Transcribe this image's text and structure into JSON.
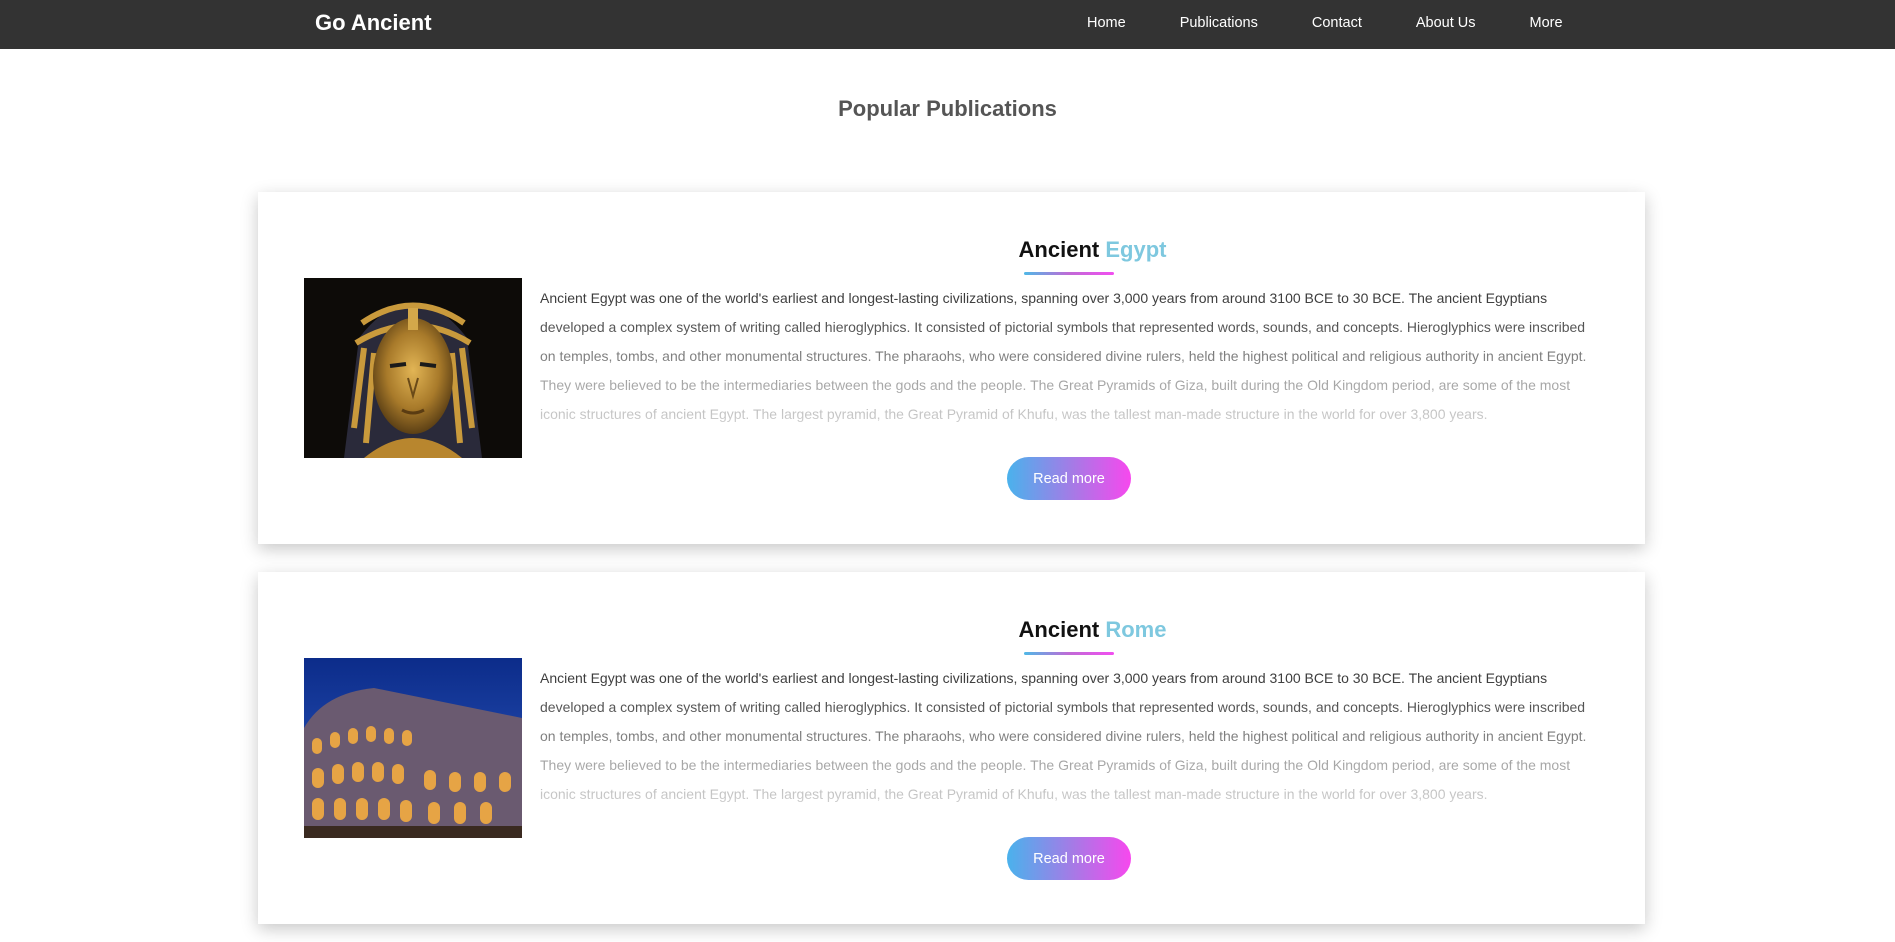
{
  "navbar": {
    "brand": "Go Ancient",
    "links": [
      "Home",
      "Publications",
      "Contact",
      "About Us",
      "More"
    ]
  },
  "section": {
    "title": "Popular Publications"
  },
  "cards": [
    {
      "title_main": "Ancient",
      "title_accent": "Egypt",
      "image": "pharaoh-mask-image",
      "text": "Ancient Egypt was one of the world's earliest and longest-lasting civilizations, spanning over 3,000 years from around 3100 BCE to 30 BCE. The ancient Egyptians developed a complex system of writing called hieroglyphics. It consisted of pictorial symbols that represented words, sounds, and concepts. Hieroglyphics were inscribed on temples, tombs, and other monumental structures. The pharaohs, who were considered divine rulers, held the highest political and religious authority in ancient Egypt. They were believed to be the intermediaries between the gods and the people. The Great Pyramids of Giza, built during the Old Kingdom period, are some of the most iconic structures of ancient Egypt. The largest pyramid, the Great Pyramid of Khufu, was the tallest man-made structure in the world for over 3,800 years.",
      "button": "Read more"
    },
    {
      "title_main": "Ancient",
      "title_accent": "Rome",
      "image": "colosseum-image",
      "text": "Ancient Egypt was one of the world's earliest and longest-lasting civilizations, spanning over 3,000 years from around 3100 BCE to 30 BCE. The ancient Egyptians developed a complex system of writing called hieroglyphics. It consisted of pictorial symbols that represented words, sounds, and concepts. Hieroglyphics were inscribed on temples, tombs, and other monumental structures. The pharaohs, who were considered divine rulers, held the highest political and religious authority in ancient Egypt. They were believed to be the intermediaries between the gods and the people. The Great Pyramids of Giza, built during the Old Kingdom period, are some of the most iconic structures of ancient Egypt. The largest pyramid, the Great Pyramid of Khufu, was the tallest man-made structure in the world for over 3,800 years.",
      "button": "Read more"
    }
  ],
  "colors": {
    "navbar_bg": "#333333",
    "accent_text": "#7ec8df",
    "button_gradient_start": "#4ab2ec",
    "button_gradient_end": "#f748ee"
  }
}
